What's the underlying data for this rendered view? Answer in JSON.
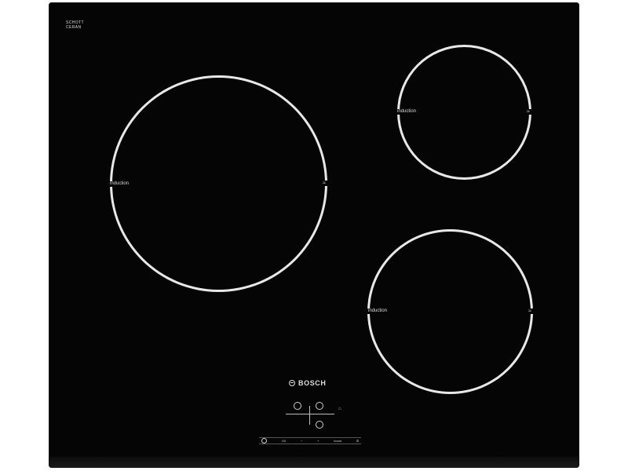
{
  "product": {
    "glass_brand_line1": "SCHOTT",
    "glass_brand_line2": "CERAN",
    "glass_brand_sub": "",
    "brand": "BOSCH"
  },
  "zones": [
    {
      "label": "induction",
      "chevron": "≈"
    },
    {
      "label": "induction",
      "chevron": "≈"
    },
    {
      "label": "induction",
      "chevron": "≈"
    }
  ],
  "controls": {
    "power_label": "O/I",
    "minus_label": "−",
    "plus_label": "+",
    "boost_label": "boost",
    "timer_label": "⏲",
    "lock_label": "⌂"
  },
  "colors": {
    "glass": "#050505",
    "markings": "#e8e8e8",
    "background": "#ffffff"
  },
  "icons": [
    "power-icon",
    "boost-icon",
    "timer-icon",
    "lock-icon",
    "bosch-logo-icon"
  ]
}
